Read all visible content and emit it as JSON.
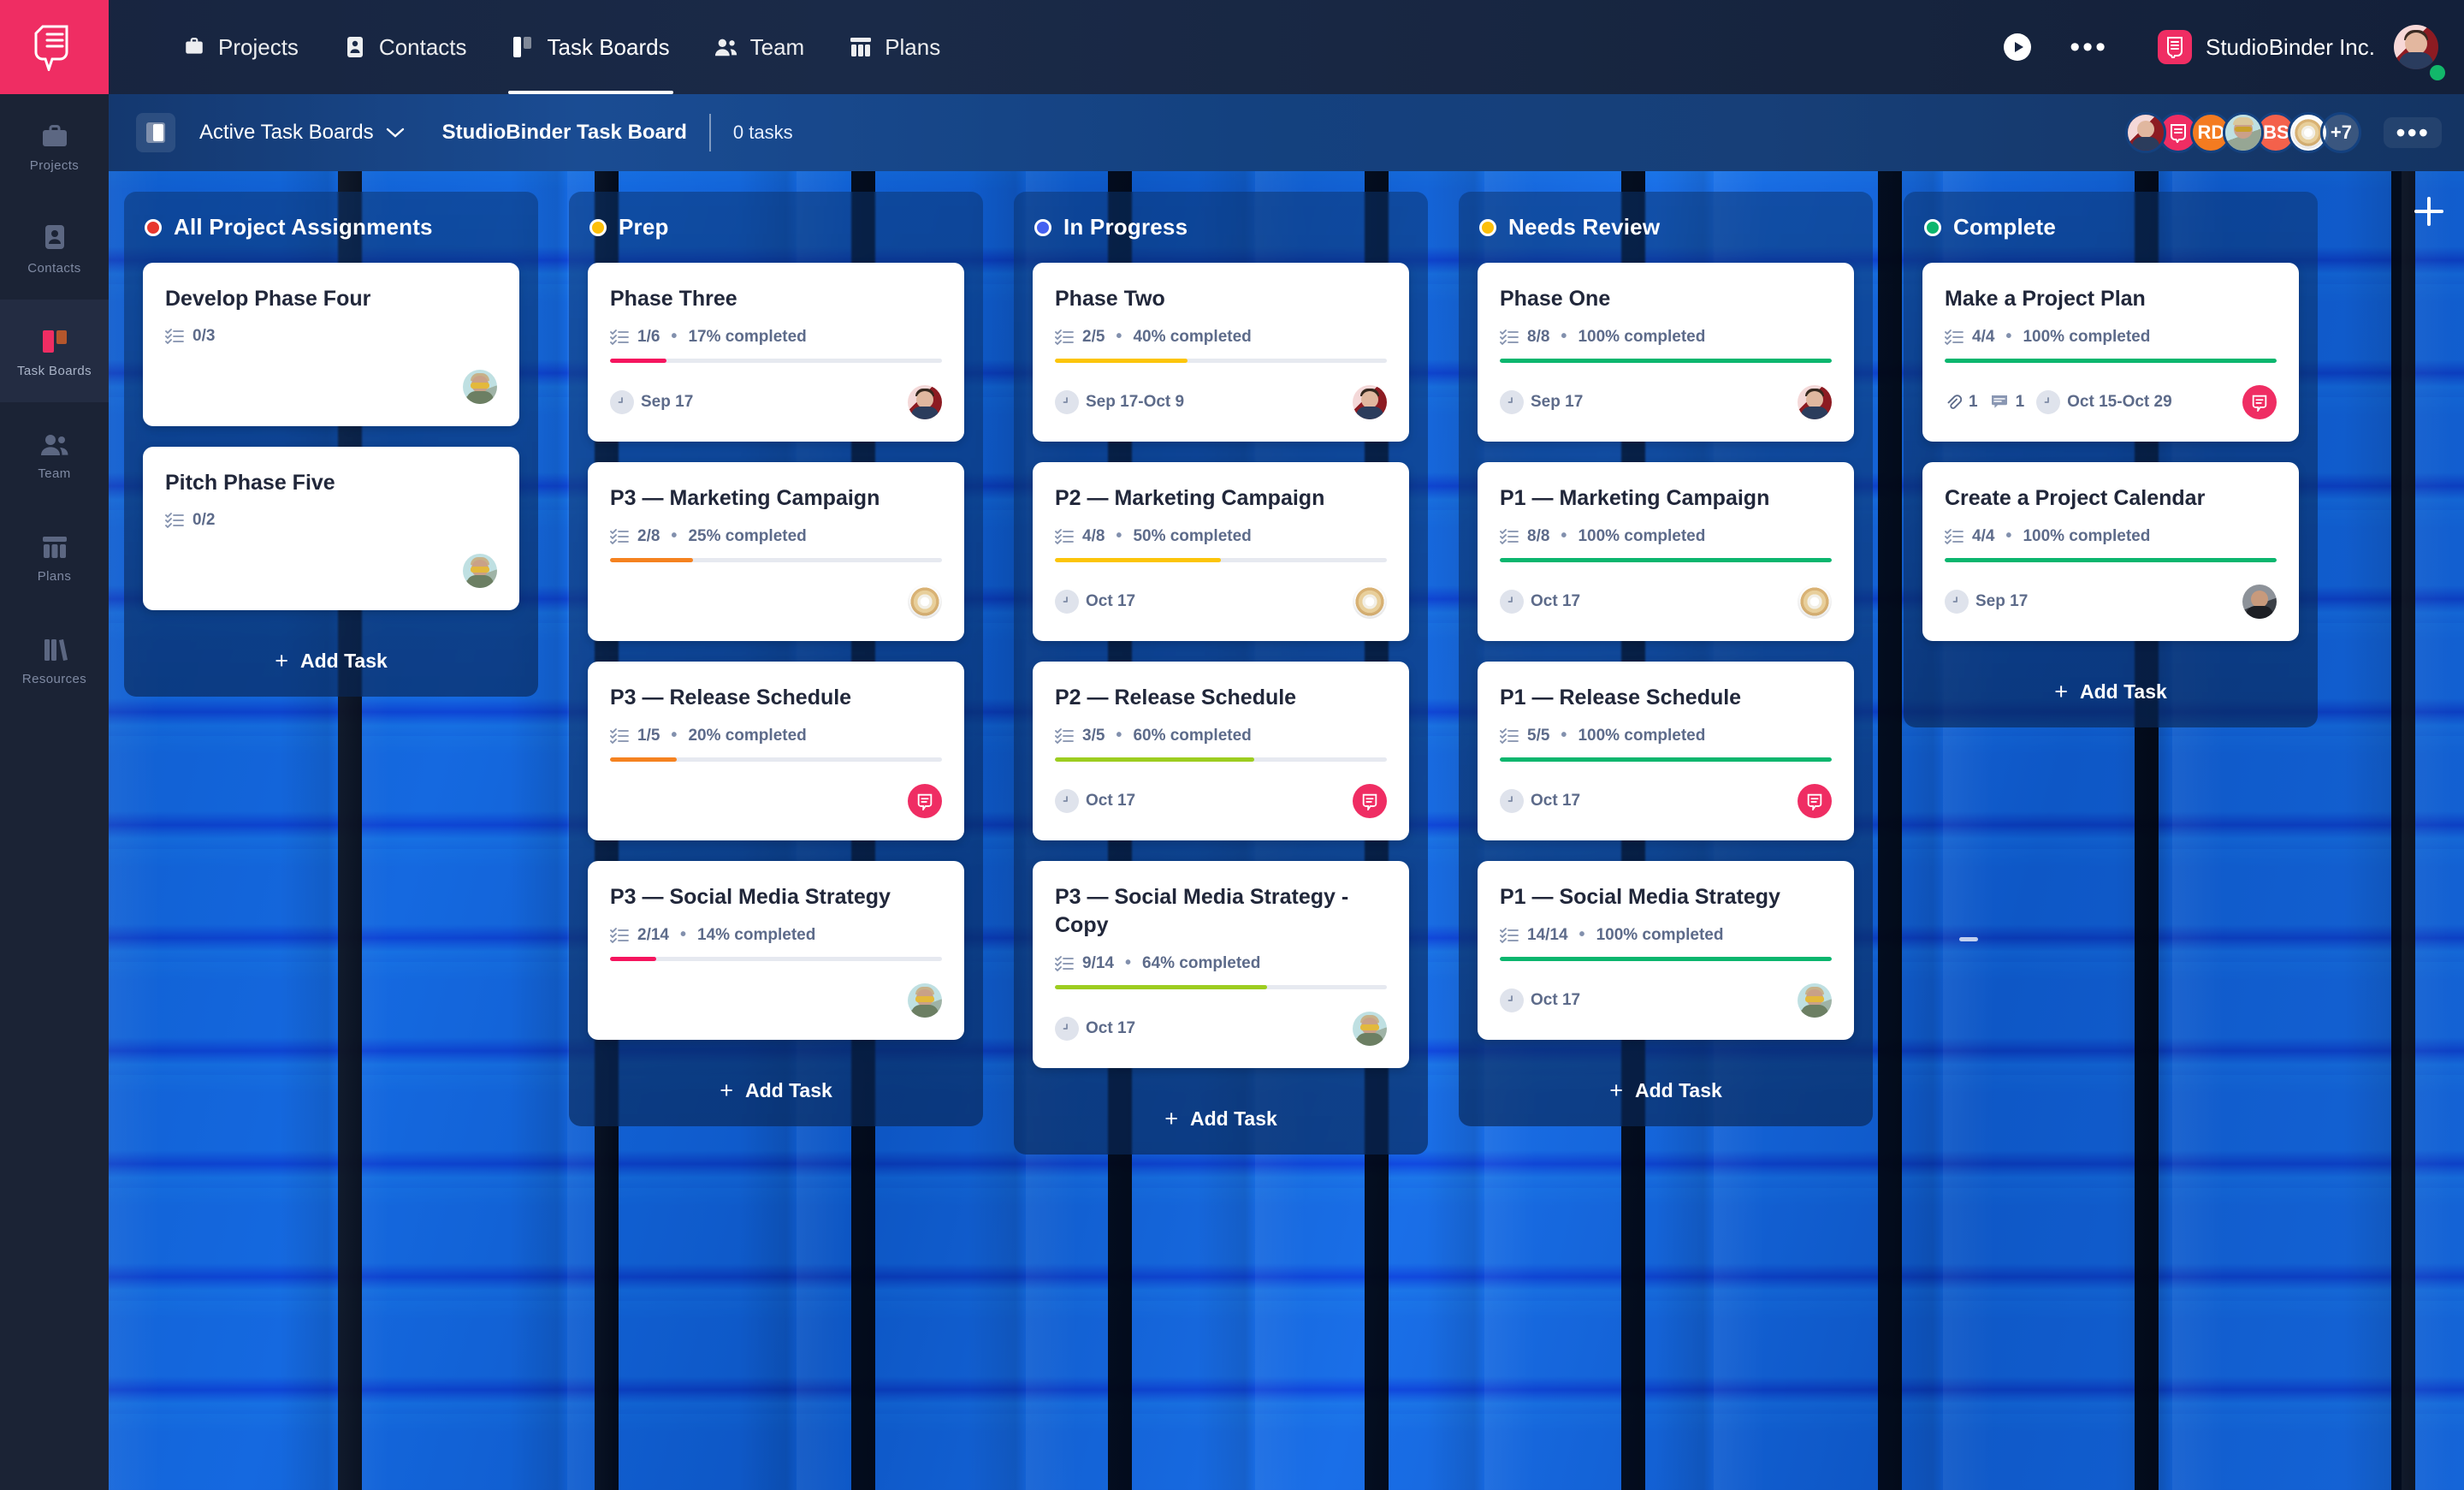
{
  "topnav": {
    "logo_icon": "studiobinder-logo-icon",
    "items": [
      {
        "label": "Projects",
        "icon": "briefcase-icon",
        "active": false
      },
      {
        "label": "Contacts",
        "icon": "contact-card-icon",
        "active": false
      },
      {
        "label": "Task Boards",
        "icon": "board-icon",
        "active": true
      },
      {
        "label": "Team",
        "icon": "people-icon",
        "active": false
      },
      {
        "label": "Plans",
        "icon": "columns-icon",
        "active": false
      }
    ],
    "play_icon": "play-circle-icon",
    "more_icon": "ellipsis-icon",
    "brand_name": "StudioBinder Inc.",
    "brand_icon": "studiobinder-mark-icon",
    "avatar_icon": "user-avatar",
    "status": "online"
  },
  "subheader": {
    "panel_toggle_icon": "panel-toggle-icon",
    "board_filter": "Active Task Boards",
    "chevron_icon": "chevron-down-icon",
    "board_name": "StudioBinder Task Board",
    "task_count": "0 tasks",
    "members": [
      {
        "type": "photo",
        "label": ""
      },
      {
        "type": "icon",
        "label": "",
        "color": "#ef2d63"
      },
      {
        "type": "initials",
        "label": "RD",
        "color": "#f47b20"
      },
      {
        "type": "photo",
        "label": ""
      },
      {
        "type": "initials",
        "label": "BS",
        "color": "#f4614b"
      },
      {
        "type": "donut",
        "label": ""
      },
      {
        "type": "overflow",
        "label": "+7"
      }
    ],
    "more_icon": "ellipsis-icon"
  },
  "rail": {
    "items": [
      {
        "label": "Projects",
        "icon": "briefcase-icon",
        "active": false
      },
      {
        "label": "Contacts",
        "icon": "contact-card-icon",
        "active": false
      },
      {
        "label": "Task Boards",
        "icon": "board-icon",
        "active": true
      },
      {
        "label": "Team",
        "icon": "people-icon",
        "active": false
      },
      {
        "label": "Plans",
        "icon": "columns-icon",
        "active": false
      },
      {
        "label": "Resources",
        "icon": "books-icon",
        "active": false
      }
    ]
  },
  "board": {
    "add_task_label": "Add Task",
    "add_column_icon": "plus-icon",
    "columns": [
      {
        "title": "All Project Assignments",
        "dot_color": "#e8372f",
        "cards": [
          {
            "title": "Develop Phase Four",
            "checklist": "0/3",
            "percent": "",
            "progress": 0,
            "bar_color": "#e6e9f0",
            "date": "",
            "attachments": "",
            "comments": "",
            "avatar": "teal-avatar"
          },
          {
            "title": "Pitch Phase Five",
            "checklist": "0/2",
            "percent": "",
            "progress": 0,
            "bar_color": "#e6e9f0",
            "date": "",
            "attachments": "",
            "comments": "",
            "avatar": "teal-avatar"
          }
        ]
      },
      {
        "title": "Prep",
        "dot_color": "#fcbf0a",
        "cards": [
          {
            "title": "P3 — Phase Three placeholder",
            "hidden": true
          },
          {
            "title": "Phase Three",
            "checklist": "1/6",
            "percent": "17% completed",
            "progress": 17,
            "bar_color": "#f5155e",
            "date": "Sep 17",
            "attachments": "",
            "comments": "",
            "avatar": "red-avatar"
          },
          {
            "title": "P3 — Marketing Campaign",
            "checklist": "2/8",
            "percent": "25% completed",
            "progress": 25,
            "bar_color": "#f58220",
            "date": "",
            "attachments": "",
            "comments": "",
            "avatar": "donut"
          },
          {
            "title": "P3 — Release Schedule",
            "checklist": "1/5",
            "percent": "20% completed",
            "progress": 20,
            "bar_color": "#f58220",
            "date": "",
            "attachments": "",
            "comments": "comment",
            "avatar": "comment"
          },
          {
            "title": "P3 — Social Media Strategy",
            "checklist": "2/14",
            "percent": "14% completed",
            "progress": 14,
            "bar_color": "#f5155e",
            "date": "",
            "attachments": "",
            "comments": "",
            "avatar": "teal-avatar"
          }
        ]
      },
      {
        "title": "In Progress",
        "dot_color": "#4460f1",
        "cards": [
          {
            "title": "Phase Two",
            "checklist": "2/5",
            "percent": "40% completed",
            "progress": 40,
            "bar_color": "#fcc50a",
            "date": "Sep 17-Oct 9",
            "attachments": "",
            "comments": "",
            "avatar": "red-avatar"
          },
          {
            "title": "P2 — Marketing Campaign",
            "checklist": "4/8",
            "percent": "50% completed",
            "progress": 50,
            "bar_color": "#fcc50a",
            "date": "Oct 17",
            "attachments": "",
            "comments": "",
            "avatar": "donut"
          },
          {
            "title": "P2 — Release Schedule",
            "checklist": "3/5",
            "percent": "60% completed",
            "progress": 60,
            "bar_color": "#9dcd20",
            "date": "Oct 17",
            "attachments": "",
            "comments": "comment",
            "avatar": "comment"
          },
          {
            "title": "P3 — Social Media Strategy - Copy",
            "checklist": "9/14",
            "percent": "64% completed",
            "progress": 64,
            "bar_color": "#9dcd20",
            "date": "Oct 17",
            "attachments": "",
            "comments": "",
            "avatar": "teal-avatar"
          }
        ]
      },
      {
        "title": "Needs Review",
        "dot_color": "#fcbf0a",
        "cards": [
          {
            "title": "Phase One",
            "checklist": "8/8",
            "percent": "100% completed",
            "progress": 100,
            "bar_color": "#0bb66e",
            "date": "Sep 17",
            "attachments": "",
            "comments": "",
            "avatar": "red-avatar"
          },
          {
            "title": "P1 — Marketing Campaign",
            "checklist": "8/8",
            "percent": "100% completed",
            "progress": 100,
            "bar_color": "#0bb66e",
            "date": "Oct 17",
            "attachments": "",
            "comments": "",
            "avatar": "donut"
          },
          {
            "title": "P1 — Release Schedule",
            "checklist": "5/5",
            "percent": "100% completed",
            "progress": 100,
            "bar_color": "#0bb66e",
            "date": "Oct 17",
            "attachments": "",
            "comments": "comment",
            "avatar": "comment"
          },
          {
            "title": "P1 — Social Media Strategy",
            "checklist": "14/14",
            "percent": "100% completed",
            "progress": 100,
            "bar_color": "#0bb66e",
            "date": "Oct 17",
            "attachments": "",
            "comments": "",
            "avatar": "teal-avatar"
          }
        ]
      },
      {
        "title": "Complete",
        "dot_color": "#0bb66e",
        "cards": [
          {
            "title": "Make a Project Plan",
            "checklist": "4/4",
            "percent": "100% completed",
            "progress": 100,
            "bar_color": "#0bb66e",
            "date": "Oct 15-Oct 29",
            "attachments": "1",
            "comments": "1",
            "avatar": "comment"
          },
          {
            "title": "Create a Project Calendar",
            "checklist": "4/4",
            "percent": "100% completed",
            "progress": 100,
            "bar_color": "#0bb66e",
            "date": "Sep 17",
            "attachments": "",
            "comments": "",
            "avatar": "gray-avatar"
          }
        ]
      }
    ]
  }
}
